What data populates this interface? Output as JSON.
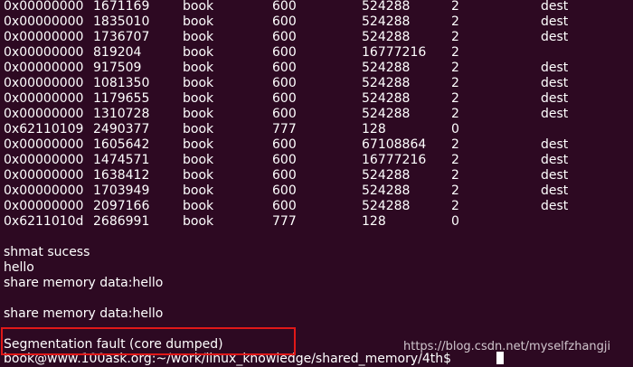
{
  "terminal": {
    "rows": [
      [
        "0x00000000",
        "1671169",
        "book",
        "600",
        "524288",
        "2",
        "dest"
      ],
      [
        "0x00000000",
        "1835010",
        "book",
        "600",
        "524288",
        "2",
        "dest"
      ],
      [
        "0x00000000",
        "1736707",
        "book",
        "600",
        "524288",
        "2",
        "dest"
      ],
      [
        "0x00000000",
        "819204",
        "book",
        "600",
        "16777216",
        "2",
        ""
      ],
      [
        "0x00000000",
        "917509",
        "book",
        "600",
        "524288",
        "2",
        "dest"
      ],
      [
        "0x00000000",
        "1081350",
        "book",
        "600",
        "524288",
        "2",
        "dest"
      ],
      [
        "0x00000000",
        "1179655",
        "book",
        "600",
        "524288",
        "2",
        "dest"
      ],
      [
        "0x00000000",
        "1310728",
        "book",
        "600",
        "524288",
        "2",
        "dest"
      ],
      [
        "0x62110109",
        "2490377",
        "book",
        "777",
        "128",
        "0",
        ""
      ],
      [
        "0x00000000",
        "1605642",
        "book",
        "600",
        "67108864",
        "2",
        "dest"
      ],
      [
        "0x00000000",
        "1474571",
        "book",
        "600",
        "16777216",
        "2",
        "dest"
      ],
      [
        "0x00000000",
        "1638412",
        "book",
        "600",
        "524288",
        "2",
        "dest"
      ],
      [
        "0x00000000",
        "1703949",
        "book",
        "600",
        "524288",
        "2",
        "dest"
      ],
      [
        "0x00000000",
        "2097166",
        "book",
        "600",
        "524288",
        "2",
        "dest"
      ],
      [
        "0x6211010d",
        "2686991",
        "book",
        "777",
        "128",
        "0",
        ""
      ]
    ],
    "output": {
      "shmat": "shmat sucess",
      "hello": "hello",
      "share_1": "share memory data:hello",
      "share_2": "share memory data:hello",
      "segfault": "Segmentation fault (core dumped)",
      "prompt": "book@www.100ask.org:~/work/linux_knowledge/shared_memory/4th$"
    }
  },
  "watermark": "https://blog.csdn.net/myselfzhangji",
  "colors": {
    "background": "#2d0922",
    "text": "#ffffff",
    "highlight_border": "#e01818"
  }
}
